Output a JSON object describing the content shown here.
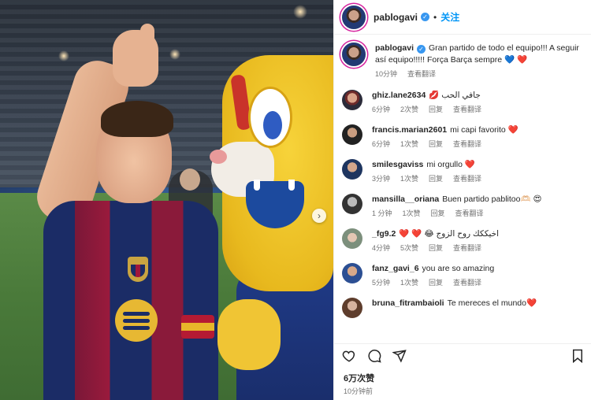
{
  "post": {
    "username": "pablogavi",
    "follow_label": "关注",
    "more_label": "…",
    "caption": "Gran partido de todo el equipo!!! A seguir así equipo!!!!! Força Barça sempre 💙 ❤️",
    "caption_time": "10分钟",
    "translate_label": "查看翻译",
    "likes": "6万次赞",
    "posted_time": "10分钟前"
  },
  "comments": [
    {
      "user": "ghiz.lane2634",
      "text": "💋 جافي الحب",
      "time": "6分钟",
      "likes": "2次赞",
      "reply": "回复",
      "translate": "查看翻译"
    },
    {
      "user": "francis.marian2601",
      "text": "mi capi favorito ❤️",
      "time": "6分钟",
      "likes": "1次赞",
      "reply": "回复",
      "translate": "查看翻译"
    },
    {
      "user": "smilesgaviss",
      "text": "mi orgullo ❤️",
      "time": "3分钟",
      "likes": "1次赞",
      "reply": "回复",
      "translate": "查看翻译"
    },
    {
      "user": "mansilla__oriana",
      "text": "Buen partido pablitoo🫶🏻 😍",
      "time": "1 分钟",
      "likes": "1次赞",
      "reply": "回复",
      "translate": "查看翻译"
    },
    {
      "user": "_fg9.2",
      "text": "❤️ ❤️ 😂 اخيككك روح الزوج",
      "time": "4分钟",
      "likes": "5次赞",
      "reply": "回复",
      "translate": "查看翻译"
    },
    {
      "user": "fanz_gavi_6",
      "text": "you are so amazing",
      "time": "5分钟",
      "likes": "1次赞",
      "reply": "回复",
      "translate": "查看翻译"
    },
    {
      "user": "bruna_fitrambaioli",
      "text": "Te mereces el mundo❤️",
      "time": "",
      "likes": "",
      "reply": "",
      "translate": ""
    }
  ],
  "icons": {
    "verified": "verified-badge-icon",
    "like": "heart-outline-icon",
    "comment": "comment-bubble-icon",
    "share": "paper-plane-icon",
    "save": "bookmark-icon",
    "next": "chevron-right-icon"
  },
  "colors": {
    "link": "#0095f6",
    "ring": "#d6249f",
    "verified": "#3897f0"
  }
}
